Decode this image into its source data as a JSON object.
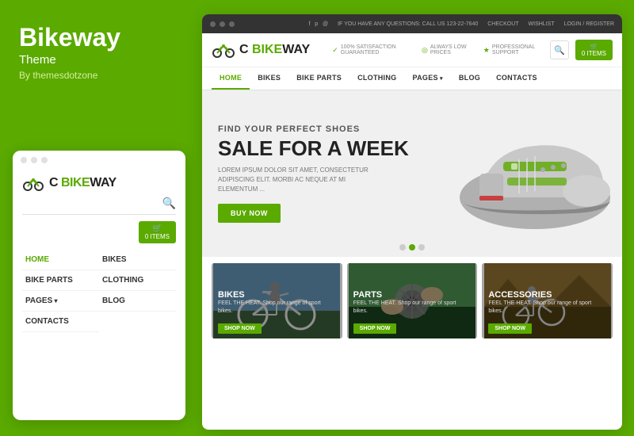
{
  "left": {
    "brand": "Bikeway",
    "theme": "Theme",
    "by": "By themesdotzone",
    "logo_text_dark": "C",
    "logo_text_green": "BIKE",
    "logo_text_end": "WAY"
  },
  "mobile": {
    "logo_dark": "C",
    "logo_green": "BIKE",
    "logo_end": "WAY",
    "cart_label": "0 ITEMS",
    "nav": [
      {
        "label": "HOME",
        "active": true,
        "arrow": false
      },
      {
        "label": "Bikes",
        "active": false,
        "arrow": false
      },
      {
        "label": "BIKE PARTS",
        "active": false,
        "arrow": false
      },
      {
        "label": "CLOTHING",
        "active": false,
        "arrow": false
      },
      {
        "label": "PAGES",
        "active": false,
        "arrow": true
      },
      {
        "label": "BLOG",
        "active": false,
        "arrow": false
      },
      {
        "label": "CONTACTS",
        "active": false,
        "arrow": false
      }
    ]
  },
  "desktop": {
    "topbar": {
      "contact": "IF YOU HAVE ANY QUESTIONS: CALL US 123-22-7640",
      "social": [
        "f",
        "p",
        "@"
      ],
      "checkout": "CHECKOUT",
      "wishlist": "WISHLIST",
      "login": "LOGIN / REGISTER"
    },
    "header": {
      "logo_dark": "C",
      "logo_green": "BIKE",
      "logo_end": "WAY",
      "badges": [
        {
          "icon": "✓",
          "text": "100% SATISFACTION GUARANTEED"
        },
        {
          "icon": "◎",
          "text": "ALWAYS LOW PRICES"
        },
        {
          "icon": "★",
          "text": "PROFESSIONAL SUPPORT"
        }
      ],
      "cart_label": "0 ITEMS"
    },
    "nav": [
      {
        "label": "HOME",
        "active": true,
        "arrow": false
      },
      {
        "label": "BIKES",
        "active": false,
        "arrow": false
      },
      {
        "label": "BIKE PARTS",
        "active": false,
        "arrow": false
      },
      {
        "label": "CLOTHING",
        "active": false,
        "arrow": false
      },
      {
        "label": "PAGES",
        "active": false,
        "arrow": true
      },
      {
        "label": "BLOG",
        "active": false,
        "arrow": false
      },
      {
        "label": "CONTACTS",
        "active": false,
        "arrow": false
      }
    ],
    "hero": {
      "subtitle": "FIND YOUR PERFECT SHOES",
      "title": "SALE FOR A WEEK",
      "desc": "LOREM IPSUM DOLOR SIT AMET, CONSECTETUR ADIPISCING ELIT. MORBI AC NEQUE AT MI ELEMENTUM ...",
      "button": "BUY NOW"
    },
    "categories": [
      {
        "title": "BIKES",
        "desc": "FEEL THE HEAT. Shop our range of sport bikes.",
        "button": "SHOP NOW",
        "color": "#4a7a9b"
      },
      {
        "title": "PARTS",
        "desc": "FEEL THE HEAT. Shop our range of sport bikes.",
        "button": "SHOP NOW",
        "color": "#2c5f2e"
      },
      {
        "title": "ACCESSORIES",
        "desc": "FEEL THE HEAT. Shop our range of sport bikes.",
        "button": "SHOP NOW",
        "color": "#6b4c11"
      }
    ]
  },
  "colors": {
    "green": "#5aaa00",
    "dark": "#333",
    "gray_bg": "#f0f0f0"
  }
}
